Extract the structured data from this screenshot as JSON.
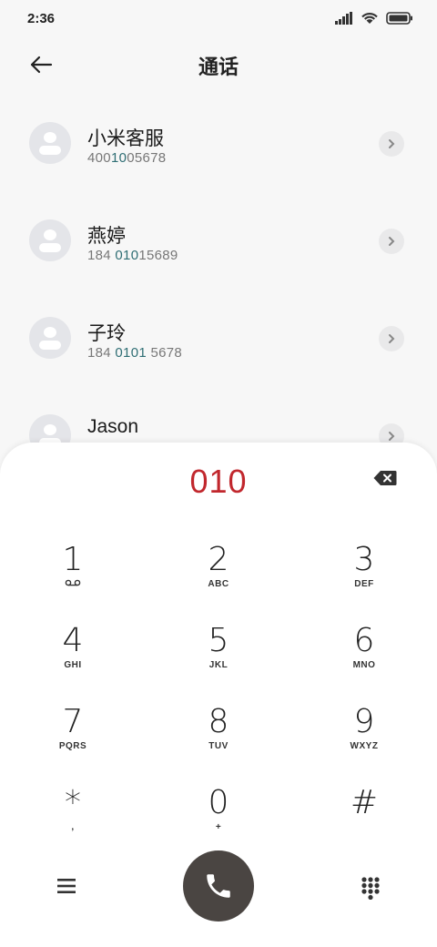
{
  "status": {
    "time": "2:36"
  },
  "header": {
    "title": "通话"
  },
  "contacts": [
    {
      "name": "小米客服",
      "num_pre": "400",
      "num_hl": "10",
      "num_post": "05678",
      "num_pre2": "",
      "num_mid": "",
      "full": "4001005678"
    },
    {
      "name": "燕婷",
      "num_pre": "184 ",
      "num_hl": "010",
      "num_post": "15689",
      "full": "184 01015689"
    },
    {
      "name": "子玲",
      "num_pre": "184 ",
      "num_hl": "0101",
      "num_post": " 5678",
      "full": "184 0101 5678"
    },
    {
      "name": "Jason",
      "num_pre": "",
      "num_hl": "",
      "num_post": "",
      "full": ""
    }
  ],
  "dialer": {
    "input": "010",
    "keys": [
      {
        "digit": "1",
        "letters": "ₒₒ"
      },
      {
        "digit": "2",
        "letters": "ABC"
      },
      {
        "digit": "3",
        "letters": "DEF"
      },
      {
        "digit": "4",
        "letters": "GHI"
      },
      {
        "digit": "5",
        "letters": "JKL"
      },
      {
        "digit": "6",
        "letters": "MNO"
      },
      {
        "digit": "7",
        "letters": "PQRS"
      },
      {
        "digit": "8",
        "letters": "TUV"
      },
      {
        "digit": "9",
        "letters": "WXYZ"
      },
      {
        "digit": "*",
        "letters": ","
      },
      {
        "digit": "0",
        "letters": "+"
      },
      {
        "digit": "#",
        "letters": ""
      }
    ]
  },
  "colors": {
    "accent": "#c1272d",
    "highlight": "#2f6e74",
    "call_button": "#4a4542"
  }
}
